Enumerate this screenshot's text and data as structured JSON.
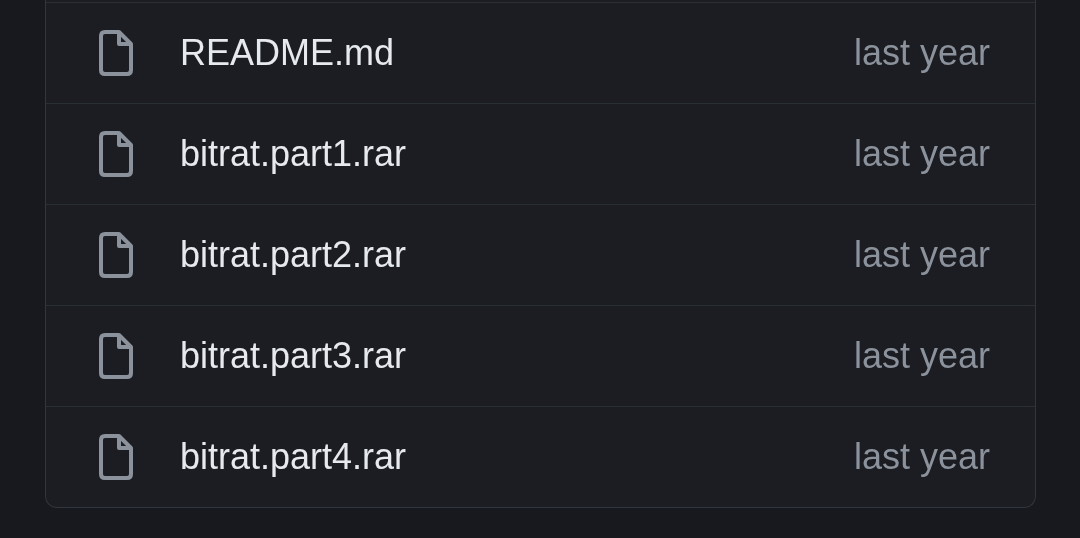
{
  "files": [
    {
      "name": "README.md",
      "updated": "last year"
    },
    {
      "name": "bitrat.part1.rar",
      "updated": "last year"
    },
    {
      "name": "bitrat.part2.rar",
      "updated": "last year"
    },
    {
      "name": "bitrat.part3.rar",
      "updated": "last year"
    },
    {
      "name": "bitrat.part4.rar",
      "updated": "last year"
    }
  ]
}
